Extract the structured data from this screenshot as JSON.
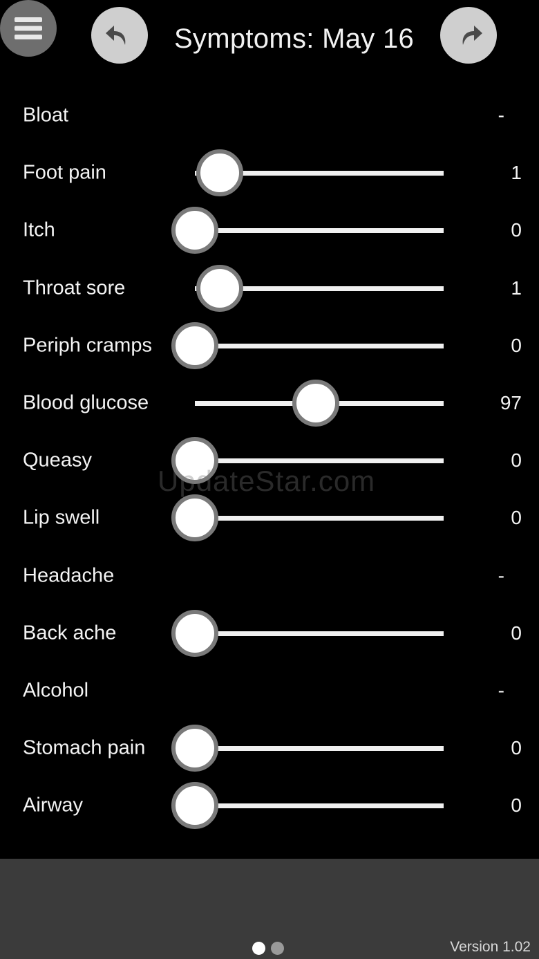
{
  "header": {
    "title": "Symptoms: May 16",
    "menu_icon": "hamburger-menu-icon",
    "undo_icon": "undo-arrow-icon",
    "redo_icon": "redo-arrow-icon"
  },
  "colors": {
    "background": "#000000",
    "button_light": "#cfcfcf",
    "menu_button": "#6e6e6e",
    "track": "#f0f0f0",
    "thumb_border": "#7a7a7a",
    "footer": "#3b3b3b"
  },
  "symptoms": [
    {
      "label": "Bloat",
      "value": "-",
      "has_slider": false
    },
    {
      "label": "Foot pain",
      "value": "1",
      "has_slider": true,
      "level": 0.1
    },
    {
      "label": "Itch",
      "value": "0",
      "has_slider": true,
      "level": 0
    },
    {
      "label": "Throat sore",
      "value": "1",
      "has_slider": true,
      "level": 0.1
    },
    {
      "label": "Periph cramps",
      "value": "0",
      "has_slider": true,
      "level": 0
    },
    {
      "label": "Blood glucose",
      "value": "97",
      "has_slider": true,
      "level": 0.485
    },
    {
      "label": "Queasy",
      "value": "0",
      "has_slider": true,
      "level": 0
    },
    {
      "label": "Lip swell",
      "value": "0",
      "has_slider": true,
      "level": 0
    },
    {
      "label": "Headache",
      "value": "-",
      "has_slider": false
    },
    {
      "label": "Back ache",
      "value": "0",
      "has_slider": true,
      "level": 0
    },
    {
      "label": "Alcohol",
      "value": "-",
      "has_slider": false
    },
    {
      "label": "Stomach pain",
      "value": "0",
      "has_slider": true,
      "level": 0
    },
    {
      "label": "Airway",
      "value": "0",
      "has_slider": true,
      "level": 0
    }
  ],
  "footer": {
    "page_count": 2,
    "active_page": 1,
    "version": "Version 1.02"
  },
  "watermark": "UpdateStar.com"
}
